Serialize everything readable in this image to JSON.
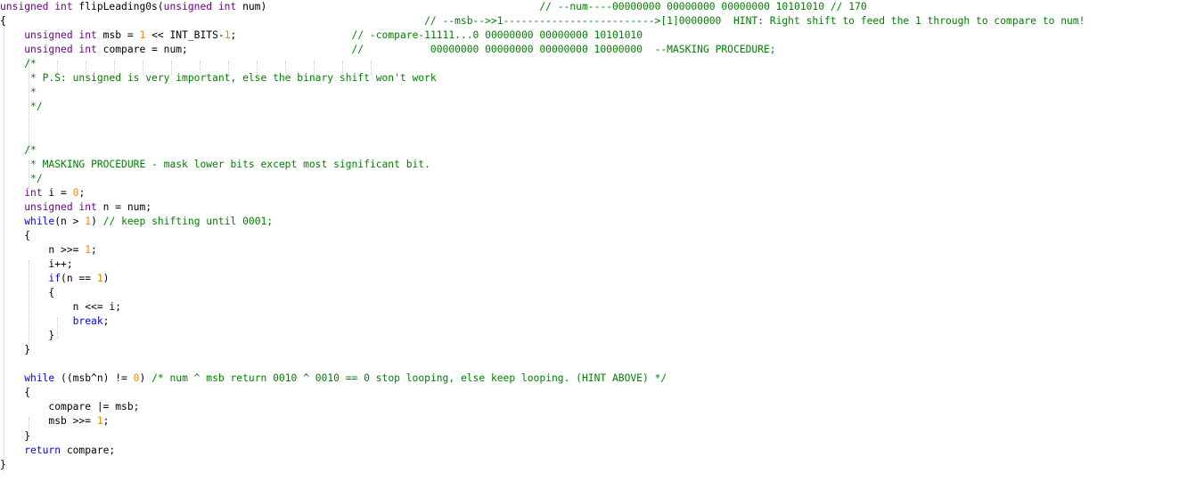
{
  "editor": {
    "colors": {
      "keyword": "#0000ff",
      "type": "#6f008a",
      "number": "#ff8000",
      "comment": "#008000",
      "text": "#000000",
      "indent_guide": "#c8c8c8"
    },
    "lines": [
      [
        {
          "t": "ty",
          "v": "unsigned int"
        },
        {
          "t": "tx",
          "v": " flipLeading0s("
        },
        {
          "t": "ty",
          "v": "unsigned int"
        },
        {
          "t": "tx",
          "v": " num)                                             "
        },
        {
          "t": "cm",
          "v": "// --num----00000000 00000000 00000000 10101010 // 170"
        }
      ],
      [
        {
          "t": "tx",
          "v": "{                                                                     "
        },
        {
          "t": "cm",
          "v": "// --msb-->>1------------------------->[1]0000000  HINT: Right shift to feed the 1 through to compare to num!"
        }
      ],
      [
        {
          "t": "tx",
          "v": "    "
        },
        {
          "t": "ty",
          "v": "unsigned int"
        },
        {
          "t": "tx",
          "v": " msb = "
        },
        {
          "t": "num",
          "v": "1"
        },
        {
          "t": "tx",
          "v": " << INT_BITS-"
        },
        {
          "t": "num",
          "v": "1"
        },
        {
          "t": "tx",
          "v": ";                   "
        },
        {
          "t": "cm",
          "v": "// -compare-11111...0 00000000 00000000 10101010"
        }
      ],
      [
        {
          "t": "tx",
          "v": "    "
        },
        {
          "t": "ty",
          "v": "unsigned int"
        },
        {
          "t": "tx",
          "v": " compare = num;                           "
        },
        {
          "t": "cm",
          "v": "//           00000000 00000000 00000000 10000000  --MASKING PROCEDURE;"
        }
      ],
      [
        {
          "t": "tx",
          "v": "    "
        },
        {
          "t": "cm",
          "v": "/*"
        }
      ],
      [
        {
          "t": "tx",
          "v": "    "
        },
        {
          "t": "cm",
          "v": " * P.S: unsigned is very important, else the binary shift won't work"
        }
      ],
      [
        {
          "t": "tx",
          "v": "    "
        },
        {
          "t": "cm",
          "v": " *"
        }
      ],
      [
        {
          "t": "tx",
          "v": "    "
        },
        {
          "t": "cm",
          "v": " */"
        }
      ],
      [
        {
          "t": "tx",
          "v": ""
        }
      ],
      [
        {
          "t": "tx",
          "v": ""
        }
      ],
      [
        {
          "t": "tx",
          "v": "    "
        },
        {
          "t": "cm",
          "v": "/*"
        }
      ],
      [
        {
          "t": "tx",
          "v": "    "
        },
        {
          "t": "cm",
          "v": " * MASKING PROCEDURE - mask lower bits except most significant bit."
        }
      ],
      [
        {
          "t": "tx",
          "v": "    "
        },
        {
          "t": "cm",
          "v": " */"
        }
      ],
      [
        {
          "t": "tx",
          "v": "    "
        },
        {
          "t": "ty",
          "v": "int"
        },
        {
          "t": "tx",
          "v": " i = "
        },
        {
          "t": "num",
          "v": "0"
        },
        {
          "t": "tx",
          "v": ";"
        }
      ],
      [
        {
          "t": "tx",
          "v": "    "
        },
        {
          "t": "ty",
          "v": "unsigned int"
        },
        {
          "t": "tx",
          "v": " n = num;"
        }
      ],
      [
        {
          "t": "tx",
          "v": "    "
        },
        {
          "t": "kw",
          "v": "while"
        },
        {
          "t": "tx",
          "v": "(n > "
        },
        {
          "t": "num",
          "v": "1"
        },
        {
          "t": "tx",
          "v": ") "
        },
        {
          "t": "cm",
          "v": "// keep shifting until 0001;"
        }
      ],
      [
        {
          "t": "tx",
          "v": "    {"
        }
      ],
      [
        {
          "t": "tx",
          "v": "        n >>= "
        },
        {
          "t": "num",
          "v": "1"
        },
        {
          "t": "tx",
          "v": ";"
        }
      ],
      [
        {
          "t": "tx",
          "v": "        i++;"
        }
      ],
      [
        {
          "t": "tx",
          "v": "        "
        },
        {
          "t": "kw",
          "v": "if"
        },
        {
          "t": "tx",
          "v": "(n == "
        },
        {
          "t": "num",
          "v": "1"
        },
        {
          "t": "tx",
          "v": ")"
        }
      ],
      [
        {
          "t": "tx",
          "v": "        {"
        }
      ],
      [
        {
          "t": "tx",
          "v": "            n <<= i;"
        }
      ],
      [
        {
          "t": "tx",
          "v": "            "
        },
        {
          "t": "kw",
          "v": "break"
        },
        {
          "t": "tx",
          "v": ";"
        }
      ],
      [
        {
          "t": "tx",
          "v": "        }"
        }
      ],
      [
        {
          "t": "tx",
          "v": "    }"
        }
      ],
      [
        {
          "t": "tx",
          "v": ""
        }
      ],
      [
        {
          "t": "tx",
          "v": "    "
        },
        {
          "t": "kw",
          "v": "while"
        },
        {
          "t": "tx",
          "v": " ((msb^n) != "
        },
        {
          "t": "num",
          "v": "0"
        },
        {
          "t": "tx",
          "v": ") "
        },
        {
          "t": "cm",
          "v": "/* num ^ msb return 0010 ^ 0010 == 0 stop looping, else keep looping. (HINT ABOVE) */"
        }
      ],
      [
        {
          "t": "tx",
          "v": "    {"
        }
      ],
      [
        {
          "t": "tx",
          "v": "        compare |= msb;"
        }
      ],
      [
        {
          "t": "tx",
          "v": "        msb >>= "
        },
        {
          "t": "num",
          "v": "1"
        },
        {
          "t": "tx",
          "v": ";"
        }
      ],
      [
        {
          "t": "tx",
          "v": "    }"
        }
      ],
      [
        {
          "t": "kw",
          "v": "    return"
        },
        {
          "t": "tx",
          "v": " compare;"
        }
      ],
      [
        {
          "t": "tx",
          "v": "}"
        }
      ]
    ]
  }
}
